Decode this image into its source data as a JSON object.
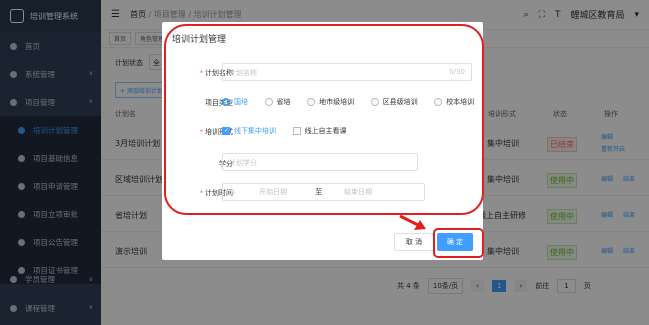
{
  "header": {
    "app_title": "培训管理系统",
    "breadcrumb": [
      "首页",
      "项目管理",
      "培训计划管理"
    ],
    "org": "鲤城区教育局"
  },
  "tags": [
    "首页",
    "角色管理"
  ],
  "sidebar": {
    "items": [
      {
        "label": "首页"
      },
      {
        "label": "系统管理"
      },
      {
        "label": "项目管理"
      },
      {
        "label": "培训计划管理"
      },
      {
        "label": "项目基础信息"
      },
      {
        "label": "项目申请管理"
      },
      {
        "label": "项目立项审批"
      },
      {
        "label": "项目公告管理"
      },
      {
        "label": "项目证书管理"
      },
      {
        "label": "学员管理"
      },
      {
        "label": "课程管理"
      }
    ]
  },
  "filter": {
    "label": "计划状态",
    "value": "全"
  },
  "table": {
    "add_button": "+ 添加培训计划",
    "headers": [
      "计划名",
      "培训形式",
      "状态",
      "操作"
    ],
    "rows": [
      {
        "name": "3月培训计划",
        "form": "集中培训",
        "status": "已结束",
        "actions": [
          "编辑",
          "重新开启"
        ]
      },
      {
        "name": "区域培训计划",
        "form": "集中培训",
        "status": "使用中",
        "actions": [
          "编辑",
          "结束"
        ]
      },
      {
        "name": "省培计划",
        "form": "线上自主研修",
        "status": "使用中",
        "actions": [
          "编辑",
          "结束"
        ]
      },
      {
        "name": "演示培训",
        "form": "集中培训",
        "status": "使用中",
        "actions": [
          "编辑",
          "结束"
        ]
      }
    ]
  },
  "pagination": {
    "total": "共 4 条",
    "page_size": "10条/页",
    "current": "1",
    "goto_label": "前往",
    "goto_value": "1",
    "page_unit": "页"
  },
  "dialog": {
    "title": "培训计划管理",
    "name_label": "计划名称",
    "name_placeholder": "计划名称",
    "name_count": "0/30",
    "type_label": "项目类型",
    "type_options": [
      "国培",
      "省培",
      "地市级培训",
      "区县级培训",
      "校本培训"
    ],
    "form_label": "培训形式",
    "form_options": [
      "线下集中培训",
      "线上自主看课"
    ],
    "credit_label": "学分",
    "credit_placeholder": "计划学分",
    "time_label": "计划时间",
    "start_placeholder": "开始日期",
    "range_sep": "至",
    "end_placeholder": "结束日期",
    "cancel": "取 消",
    "confirm": "确 定"
  }
}
